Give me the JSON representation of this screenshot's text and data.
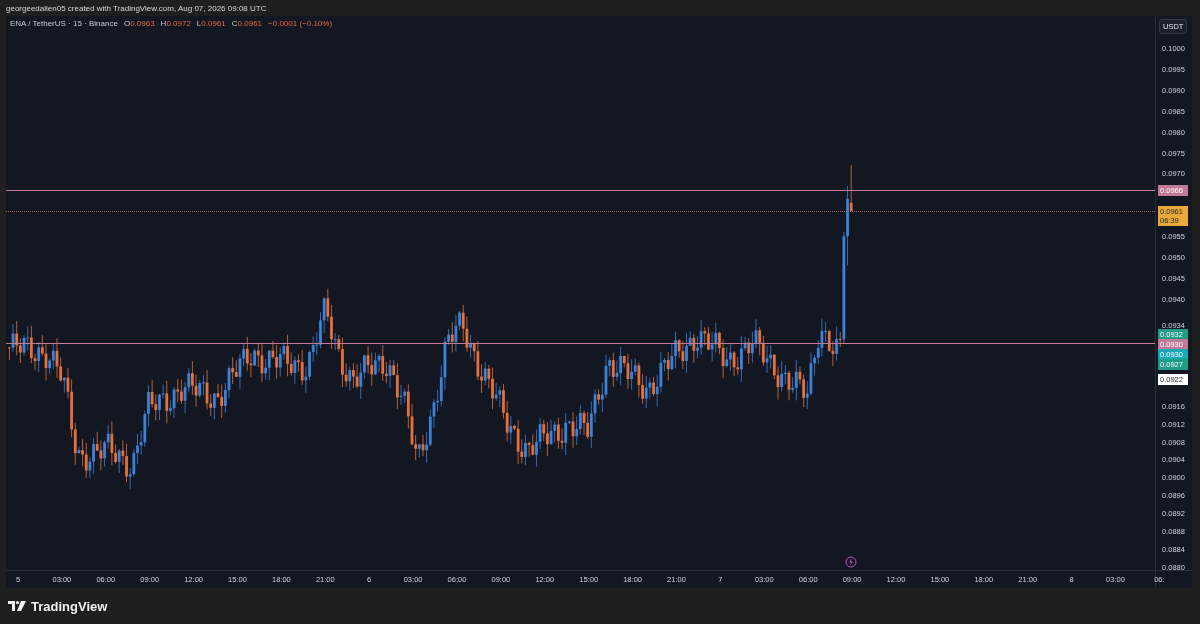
{
  "header": "georgeedallen05 created with TradingView.com, Aug 07, 2026 09:08 UTC",
  "legend": {
    "symbol": "ENA / TetherUS · 15 · Binance",
    "ohlc": [
      {
        "key": "O",
        "value": "0.0963"
      },
      {
        "key": "H",
        "value": "0.0972"
      },
      {
        "key": "L",
        "value": "0.0961"
      },
      {
        "key": "C",
        "value": "0.0961"
      }
    ],
    "change": "−0.0001 (−0.10%)"
  },
  "currency": "USDT",
  "price_ticks": [
    "0.1000",
    "0.0995",
    "0.0990",
    "0.0985",
    "0.0980",
    "0.0975",
    "0.0970",
    "0.0955",
    "0.0950",
    "0.0945",
    "0.0940",
    "0.0934",
    "0.0916",
    "0.0912",
    "0.0908",
    "0.0904",
    "0.0900",
    "0.0896",
    "0.0892",
    "0.0888",
    "0.0884",
    "0.0880"
  ],
  "price_labels": [
    {
      "text": "0.0966",
      "color": "#c27a98",
      "kind": "line"
    },
    {
      "text": "0.0961",
      "countdown": "06:39",
      "color": "#e9a83a",
      "kind": "last"
    },
    {
      "text": "0.0932",
      "color": "#1f9b86",
      "kind": "marker"
    },
    {
      "text": "0.0930",
      "color": "#c27a98",
      "kind": "line"
    },
    {
      "text": "0.0930",
      "color": "#16a9b8",
      "kind": "marker"
    },
    {
      "text": "0.0927",
      "color": "#1f9b86",
      "kind": "marker"
    },
    {
      "text": "0.0922",
      "color": "#ffffff",
      "kind": "marker"
    }
  ],
  "time_ticks": [
    "5",
    "03:00",
    "06:00",
    "09:00",
    "12:00",
    "15:00",
    "18:00",
    "21:00",
    "6",
    "03:00",
    "06:00",
    "09:00",
    "12:00",
    "15:00",
    "18:00",
    "21:00",
    "7",
    "03:00",
    "06:00",
    "09:00",
    "12:00",
    "15:00",
    "18:00",
    "21:00",
    "8",
    "03:00",
    "06:"
  ],
  "brand": "TradingView"
}
